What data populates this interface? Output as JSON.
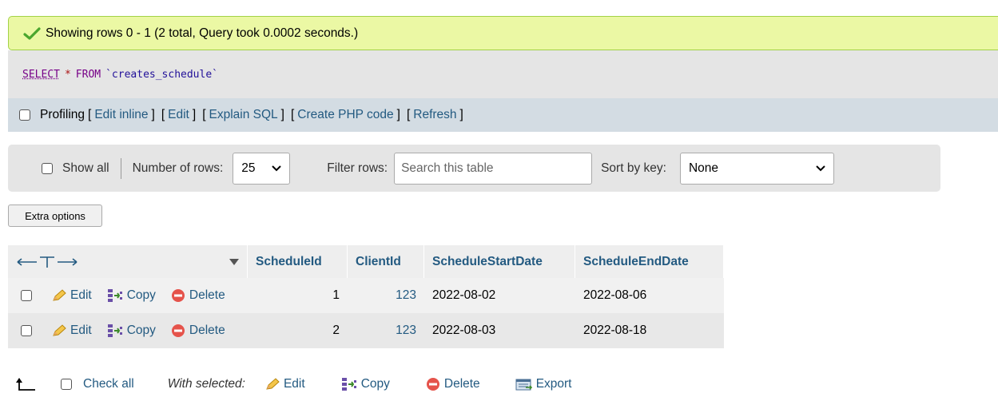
{
  "message": {
    "text": "Showing rows 0 - 1 (2 total, Query took 0.0002 seconds.)"
  },
  "sql": {
    "select": "SELECT",
    "star": "*",
    "from": "FROM",
    "table": "`creates_schedule`"
  },
  "profiling": {
    "label": "Profiling",
    "links": [
      "Edit inline",
      "Edit",
      "Explain SQL",
      "Create PHP code",
      "Refresh"
    ]
  },
  "nav": {
    "show_all": "Show all",
    "num_rows_label": "Number of rows:",
    "num_rows_value": "25",
    "filter_label": "Filter rows:",
    "filter_placeholder": "Search this table",
    "sort_label": "Sort by key:",
    "sort_value": "None"
  },
  "extra_options": "Extra options",
  "table": {
    "columns": [
      "ScheduleId",
      "ClientId",
      "ScheduleStartDate",
      "ScheduleEndDate"
    ],
    "row_actions": {
      "edit": "Edit",
      "copy": "Copy",
      "delete": "Delete"
    },
    "rows": [
      {
        "ScheduleId": "1",
        "ClientId": "123",
        "ScheduleStartDate": "2022-08-02",
        "ScheduleEndDate": "2022-08-06"
      },
      {
        "ScheduleId": "2",
        "ClientId": "123",
        "ScheduleStartDate": "2022-08-03",
        "ScheduleEndDate": "2022-08-18"
      }
    ]
  },
  "bottom": {
    "check_all": "Check all",
    "with_selected": "With selected:",
    "edit": "Edit",
    "copy": "Copy",
    "delete": "Delete",
    "export": "Export"
  },
  "colors": {
    "link": "#235a81",
    "success_bg": "#ebf8a4",
    "header_bg": "#d3dce3"
  },
  "icons": [
    "check-icon",
    "pencil-icon",
    "copy-icon",
    "delete-icon",
    "export-icon",
    "arrow-icon",
    "chevron-down-icon",
    "sort-arrow-icon"
  ]
}
